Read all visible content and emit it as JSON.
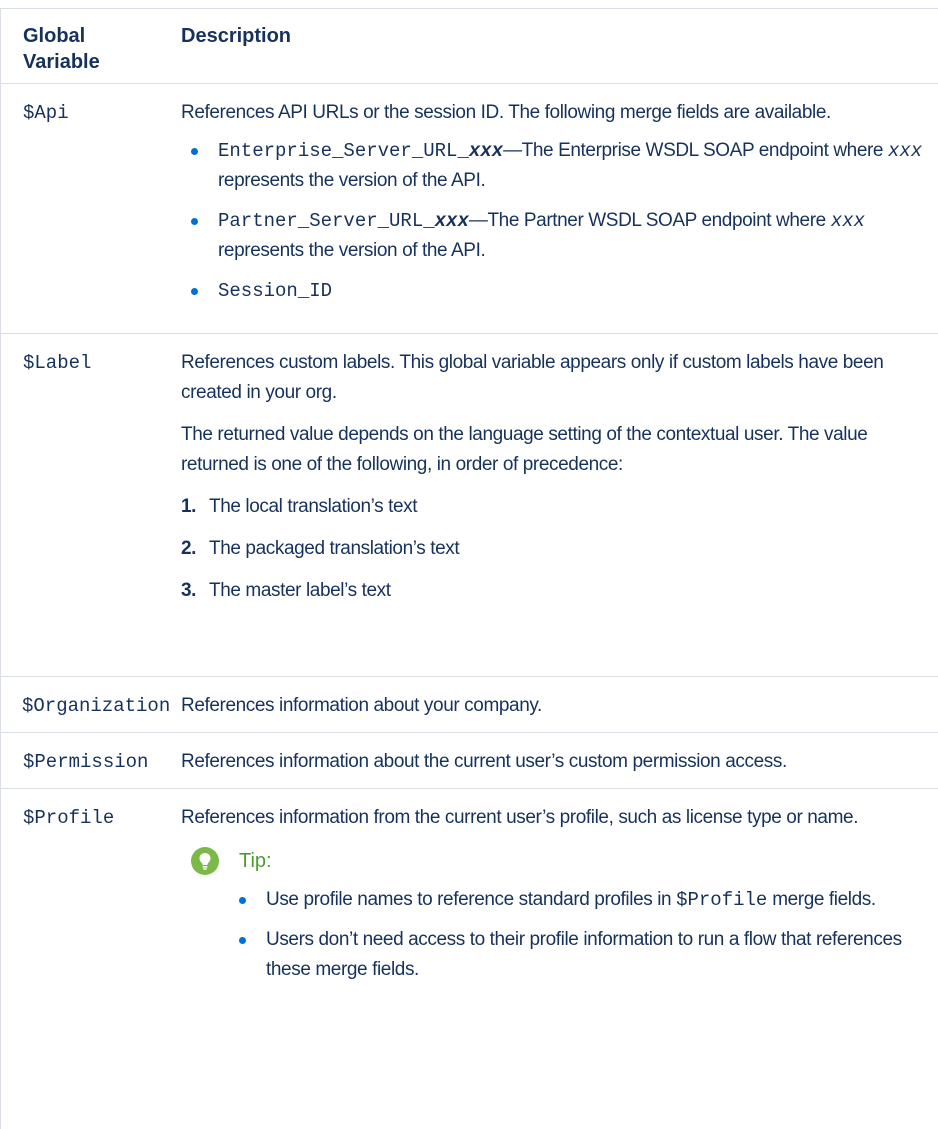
{
  "table": {
    "header": {
      "col1_line1": "Global",
      "col1_line2": "Variable",
      "col2": "Description"
    },
    "rows": {
      "api": {
        "variable": "$Api",
        "description": "References API URLs or the session ID. The following merge fields are available.",
        "bullets": [
          {
            "code": "Enterprise_Server_URL_",
            "code_em": "xxx",
            "text_a": "—The Enterprise WSDL SOAP endpoint where ",
            "code_it": "xxx",
            "text_b": " represents the version of the API."
          },
          {
            "code": "Partner_Server_URL_",
            "code_em": "xxx",
            "text_a": "—The Partner WSDL SOAP endpoint where ",
            "code_it": "xxx",
            "text_b": " represents the version of the API."
          },
          {
            "code": "Session_ID"
          }
        ]
      },
      "label": {
        "variable": "$Label",
        "description_1": "References custom labels. This global variable appears only if custom labels have been created in your org.",
        "description_2": "The returned value depends on the language setting of the contextual user. The value returned is one of the following, in order of precedence:",
        "ordered": [
          {
            "num": "1.",
            "text": "The local translation’s text"
          },
          {
            "num": "2.",
            "text": "The packaged translation’s text"
          },
          {
            "num": "3.",
            "text": "The master label’s text"
          }
        ]
      },
      "organization": {
        "variable": "$Organization",
        "description": "References information about your company."
      },
      "permission": {
        "variable": "$Permission",
        "description": "References information about the current user’s custom permission access."
      },
      "profile": {
        "variable": "$Profile",
        "description": "References information from the current user’s profile, such as license type or name.",
        "tip": {
          "icon": "lightbulb-icon",
          "label": "Tip:",
          "bullets": [
            {
              "text_a": "Use profile names to reference standard profiles in ",
              "code": "$Profile",
              "text_b": " merge fields."
            },
            {
              "text_a": "Users don’t need access to their profile information to run a flow that references these merge fields."
            }
          ]
        }
      }
    }
  },
  "colors": {
    "text": "#16325c",
    "bullet": "#0070d2",
    "tip_icon": "#7bb949",
    "tip_label": "#4a9e2f",
    "border": "#d8dde6"
  }
}
